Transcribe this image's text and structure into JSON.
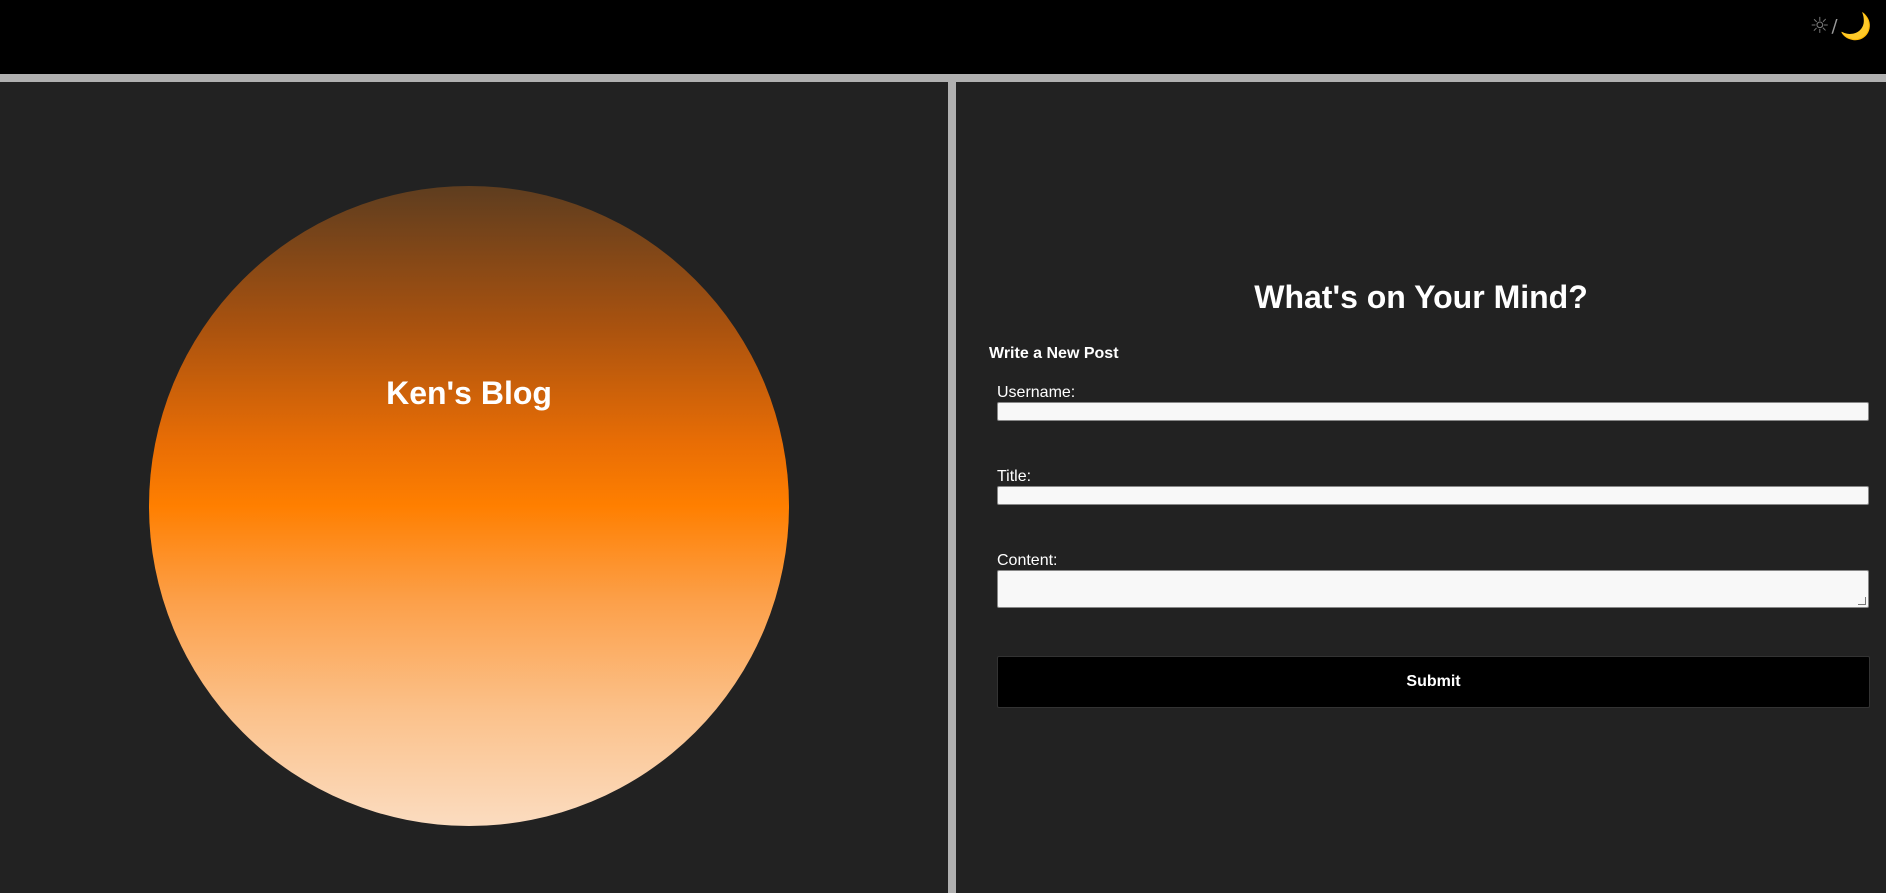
{
  "theme_toggle": {
    "sun_icon": "☼",
    "separator": "/",
    "moon_icon": "🌙"
  },
  "blog": {
    "title": "Ken's Blog"
  },
  "form": {
    "heading": "What's on Your Mind?",
    "subheading": "Write a New Post",
    "username_label": "Username:",
    "username_value": "",
    "title_label": "Title:",
    "title_value": "",
    "content_label": "Content:",
    "content_value": "",
    "submit_label": "Submit"
  },
  "colors": {
    "topbar": "#000000",
    "background": "#222222",
    "rule": "#b0b0b0",
    "accent": "#ff7f00"
  }
}
